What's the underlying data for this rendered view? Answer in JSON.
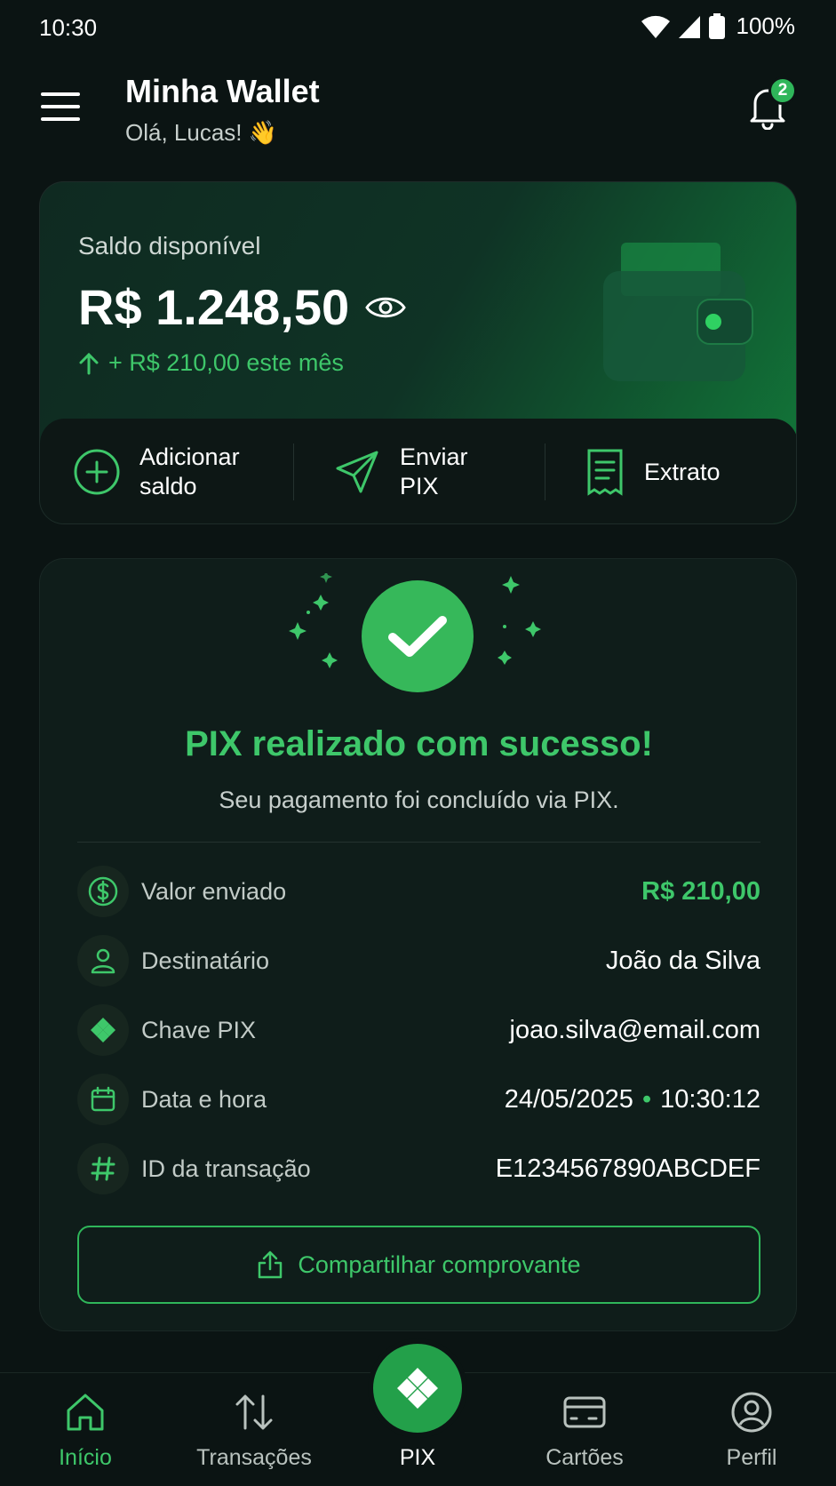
{
  "status_bar": {
    "time": "10:30",
    "battery": "100%"
  },
  "header": {
    "title": "Minha Wallet",
    "greeting": "Olá, Lucas! 👋",
    "notification_count": "2"
  },
  "balance": {
    "label": "Saldo disponível",
    "value": "R$ 1.248,50",
    "change": "+ R$ 210,00 este mês",
    "actions": [
      {
        "label_line1": "Adicionar",
        "label_line2": "saldo"
      },
      {
        "label_line1": "Enviar",
        "label_line2": "PIX"
      },
      {
        "label_line1": "Extrato",
        "label_line2": ""
      }
    ]
  },
  "success": {
    "title": "PIX realizado com sucesso!",
    "subtitle": "Seu pagamento foi concluído via PIX.",
    "details": [
      {
        "label": "Valor enviado",
        "value": "R$ 210,00"
      },
      {
        "label": "Destinatário",
        "value": "João da Silva"
      },
      {
        "label": "Chave PIX",
        "value": "joao.silva@email.com"
      },
      {
        "label": "Data e hora",
        "date": "24/05/2025",
        "sep": "•",
        "time": "10:30:12"
      },
      {
        "label": "ID da transação",
        "value": "E1234567890ABCDEF"
      }
    ],
    "share_label": "Compartilhar comprovante"
  },
  "nav": {
    "items": [
      {
        "label": "Início"
      },
      {
        "label": "Transações"
      },
      {
        "label": "PIX"
      },
      {
        "label": "Cartões"
      },
      {
        "label": "Perfil"
      }
    ],
    "active": "Início"
  },
  "colors": {
    "accent": "#3ec76a",
    "background": "#0b1413",
    "card": "#0f1d1a"
  }
}
